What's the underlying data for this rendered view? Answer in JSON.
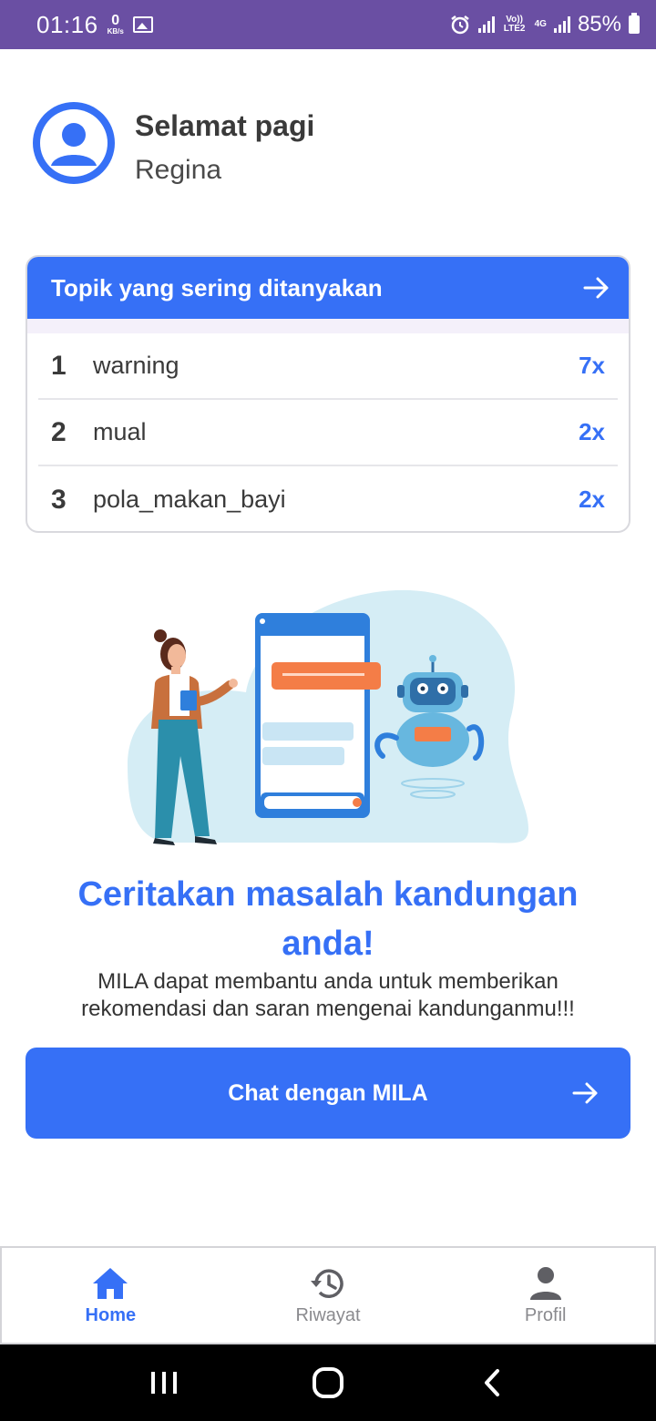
{
  "status_bar": {
    "time": "01:16",
    "net_speed_value": "0",
    "net_speed_unit": "KB/s",
    "volte_label": "Vo)) LTE2",
    "network_type": "4G",
    "battery": "85%"
  },
  "header": {
    "greeting": "Selamat pagi",
    "user_name": "Regina"
  },
  "topics_card": {
    "title": "Topik yang sering ditanyakan",
    "items": [
      {
        "rank": "1",
        "topic": "warning",
        "count": "7x"
      },
      {
        "rank": "2",
        "topic": "mual",
        "count": "2x"
      },
      {
        "rank": "3",
        "topic": "pola_makan_bayi",
        "count": "2x"
      }
    ]
  },
  "cta": {
    "title": "Ceritakan masalah kandungan anda!",
    "description": "MILA dapat membantu anda untuk memberikan rekomendasi dan saran mengenai kandunganmu!!!",
    "button_label": "Chat dengan MILA"
  },
  "bottom_nav": {
    "items": [
      {
        "label": "Home",
        "icon": "home-icon",
        "active": true
      },
      {
        "label": "Riwayat",
        "icon": "history-icon",
        "active": false
      },
      {
        "label": "Profil",
        "icon": "person-icon",
        "active": false
      }
    ]
  },
  "colors": {
    "primary": "#3670f6",
    "status_bar": "#6a4fa3",
    "text_dark": "#3a3a3a",
    "nav_inactive": "#8a8a8e"
  }
}
